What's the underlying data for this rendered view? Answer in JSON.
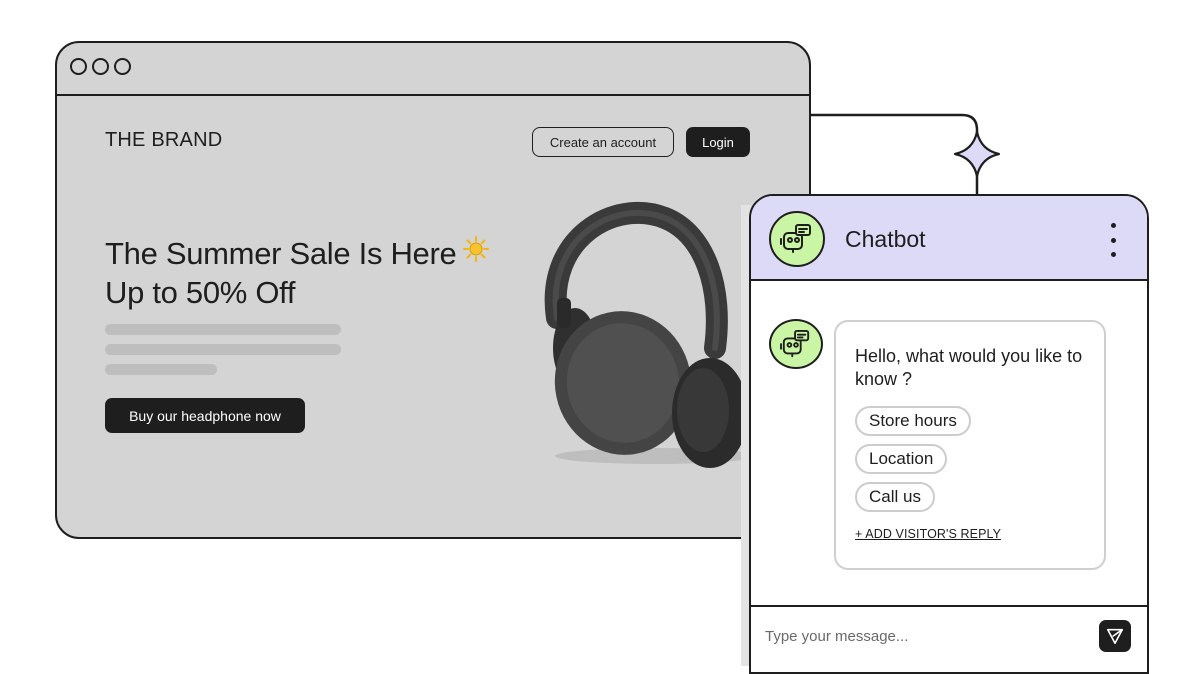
{
  "browser": {
    "brand": "THE BRAND",
    "nav": {
      "create_account": "Create an account",
      "login": "Login"
    },
    "hero": {
      "title_line1": "The Summer Sale Is Here",
      "title_line2": "Up to 50% Off",
      "cta": "Buy our headphone now"
    },
    "icons": [
      "window-dot-icon",
      "sun-icon",
      "headphones-image"
    ]
  },
  "chatbot": {
    "title": "Chatbot",
    "greeting": "Hello, what would you like to know ?",
    "options": [
      "Store hours",
      "Location",
      "Call us"
    ],
    "add_reply": "+ ADD VISITOR'S  REPLY",
    "input_placeholder": "Type your message...",
    "icons": [
      "bot-icon",
      "kebab-menu-icon",
      "send-icon",
      "sparkle-icon"
    ]
  },
  "colors": {
    "browser_bg": "#d4d4d4",
    "outline": "#1e1e1e",
    "chat_header_bg": "#dcdaf6",
    "bot_avatar_bg": "#c9f5a5",
    "dark_button": "#1e1e1e",
    "skeleton": "#bebebe",
    "sun": "#f2b705"
  }
}
